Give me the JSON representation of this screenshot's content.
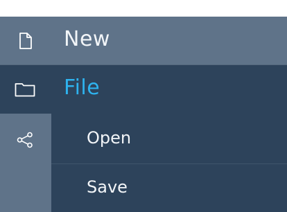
{
  "menu": {
    "items": [
      {
        "label": "New",
        "icon": "document-icon"
      },
      {
        "label": "File",
        "icon": "folder-icon"
      }
    ],
    "share_icon": "share-icon",
    "submenu": [
      {
        "label": "Open"
      },
      {
        "label": "Save"
      }
    ]
  },
  "colors": {
    "top_row": "#5f7389",
    "active_row": "#2d435b",
    "active_text": "#2eb3ef",
    "text": "#f2f5f8"
  }
}
